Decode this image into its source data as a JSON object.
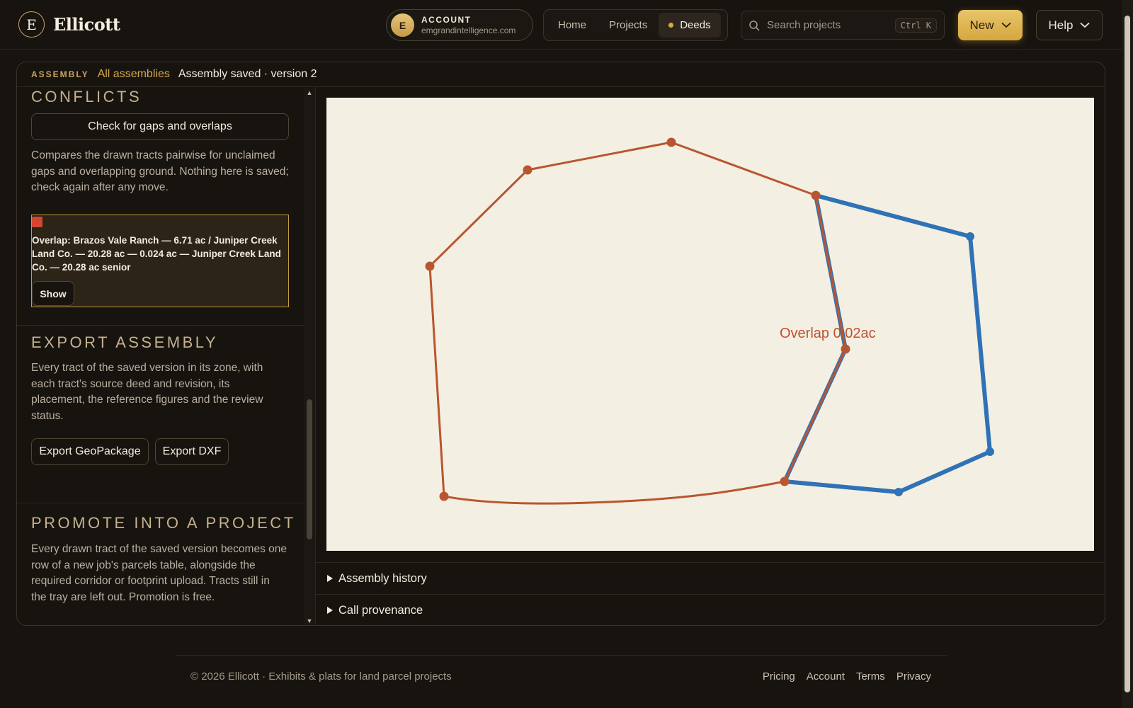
{
  "header": {
    "logo_letter": "E",
    "app_name": "Ellicott",
    "account": {
      "avatar_initial": "E",
      "label": "ACCOUNT",
      "email": "emgrandintelligence.com"
    },
    "nav": [
      {
        "label": "Home",
        "active": false
      },
      {
        "label": "Projects",
        "active": false
      },
      {
        "label": "Deeds",
        "active": true
      }
    ],
    "search": {
      "placeholder": "Search projects",
      "shortcut": "Ctrl K"
    },
    "new_label": "New",
    "help_label": "Help"
  },
  "assembly": {
    "kicker": "ASSEMBLY",
    "back_link": "All assemblies",
    "status": "Assembly saved · version 2"
  },
  "sidebar": {
    "conflicts": {
      "title": "CONFLICTS",
      "button": "Check for gaps and overlaps",
      "description": "Compares the drawn tracts pairwise for unclaimed gaps and overlapping ground. Nothing here is saved; check again after any move.",
      "result": {
        "text": "Overlap: Brazos Vale Ranch — 6.71 ac / Juniper Creek Land Co. — 20.28 ac — 0.024 ac — Juniper Creek Land Co. — 20.28 ac senior",
        "show_label": "Show"
      }
    },
    "export": {
      "title": "EXPORT ASSEMBLY",
      "description": "Every tract of the saved version in its zone, with each tract's source deed and revision, its placement, the reference figures and the review status.",
      "buttons": [
        "Export GeoPackage",
        "Export DXF"
      ]
    },
    "promote": {
      "title": "PROMOTE INTO A PROJECT",
      "description": "Every drawn tract of the saved version becomes one row of a new job's parcels table, alongside the required corridor or footprint upload. Tracts still in the tray are left out. Promotion is free."
    }
  },
  "map": {
    "overlap_label": "Overlap 0.02ac",
    "colors": {
      "tract_a": "#b9562f",
      "tract_b": "#2f72b5",
      "canvas": "#f4efe3",
      "label": "#c0502e"
    }
  },
  "disclosures": [
    "Assembly history",
    "Call provenance"
  ],
  "footer": {
    "copyright": "© 2026 Ellicott · Exhibits & plats for land parcel projects",
    "links": [
      "Pricing",
      "Account",
      "Terms",
      "Privacy"
    ]
  }
}
